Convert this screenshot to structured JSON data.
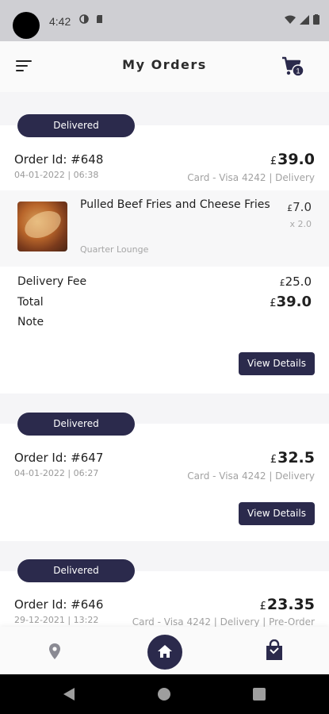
{
  "status_bar": {
    "time": "4:42"
  },
  "header": {
    "title": "My Orders",
    "cart_count": "1"
  },
  "orders": [
    {
      "status": "Delivered",
      "order_id": "Order Id: #648",
      "date": "04-01-2022 | 06:38",
      "currency": "£",
      "total": "39.0",
      "payment": "Card - Visa 4242 | Delivery",
      "item": {
        "name": "Pulled Beef Fries and Cheese Fries",
        "vendor": "Quarter Lounge",
        "currency": "£",
        "price": "7.0",
        "qty": "x 2.0"
      },
      "delivery_fee_label": "Delivery Fee",
      "delivery_fee": "25.0",
      "total_label": "Total",
      "total_value": "39.0",
      "note_label": "Note",
      "button": "View Details"
    },
    {
      "status": "Delivered",
      "order_id": "Order Id: #647",
      "date": "04-01-2022 | 06:27",
      "currency": "£",
      "total": "32.5",
      "payment": "Card - Visa 4242 | Delivery",
      "button": "View Details"
    },
    {
      "status": "Delivered",
      "order_id": "Order Id: #646",
      "date": "29-12-2021 | 13:22",
      "currency": "£",
      "total": "23.35",
      "payment": "Card - Visa 4242 | Delivery | Pre-Order"
    }
  ],
  "bottom_nav": {
    "items": [
      {
        "icon": "location-pin-icon"
      },
      {
        "icon": "home-icon"
      },
      {
        "icon": "shopping-bag-icon"
      }
    ]
  },
  "colors": {
    "accent": "#2b2a4c",
    "status_bar": "#cfcfd3"
  }
}
